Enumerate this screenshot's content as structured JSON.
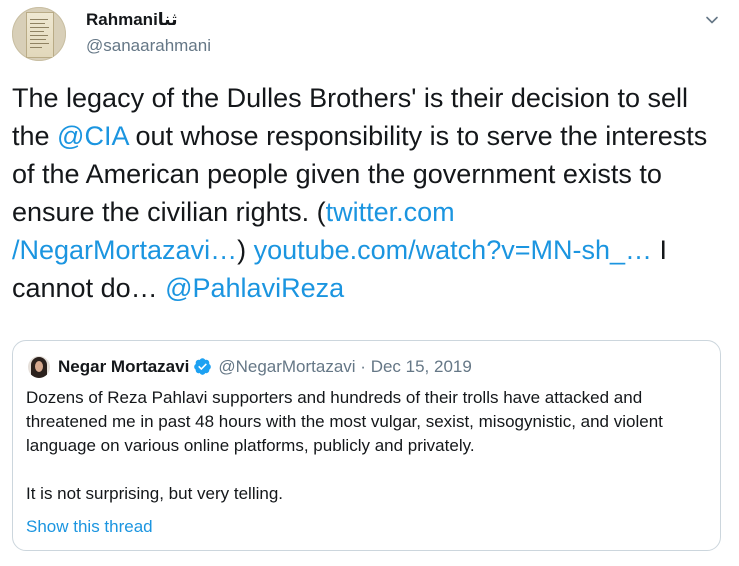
{
  "tweet": {
    "author": {
      "display_name": "Rahmaniثنا",
      "handle": "@sanaarahmani",
      "avatar_icon": "document-avatar-icon"
    },
    "menu_icon": "chevron-down-icon",
    "text": {
      "t1": "The legacy of the Dulles Brothers' is their decision to sell the ",
      "mention_cia": "@CIA",
      "t2": " out whose responsibility is to serve the interests of the American people given the government exists to ensure the civilian rights. (",
      "link_twitter_a": "twitter.com",
      "link_twitter_b": "/NegarMortazavi…",
      "t3": ") ",
      "link_youtube": "youtube.com/watch?v=MN-sh_…",
      "t4": " I cannot do… ",
      "mention_pahlavi": "@PahlaviReza"
    },
    "link_color": "#1b95e0"
  },
  "quoted_tweet": {
    "author": {
      "display_name": "Negar Mortazavi",
      "verified_icon": "verified-badge-icon",
      "handle": "@NegarMortazavi",
      "separator": " · ",
      "date": "Dec 15, 2019"
    },
    "paragraphs": [
      "Dozens of Reza Pahlavi supporters and hundreds of their trolls have attacked and threatened me in past 48 hours with the most vulgar, sexist, misogynistic, and violent language on various online platforms, publicly and privately.",
      "It is not surprising, but very telling."
    ],
    "show_thread": "Show this thread"
  }
}
